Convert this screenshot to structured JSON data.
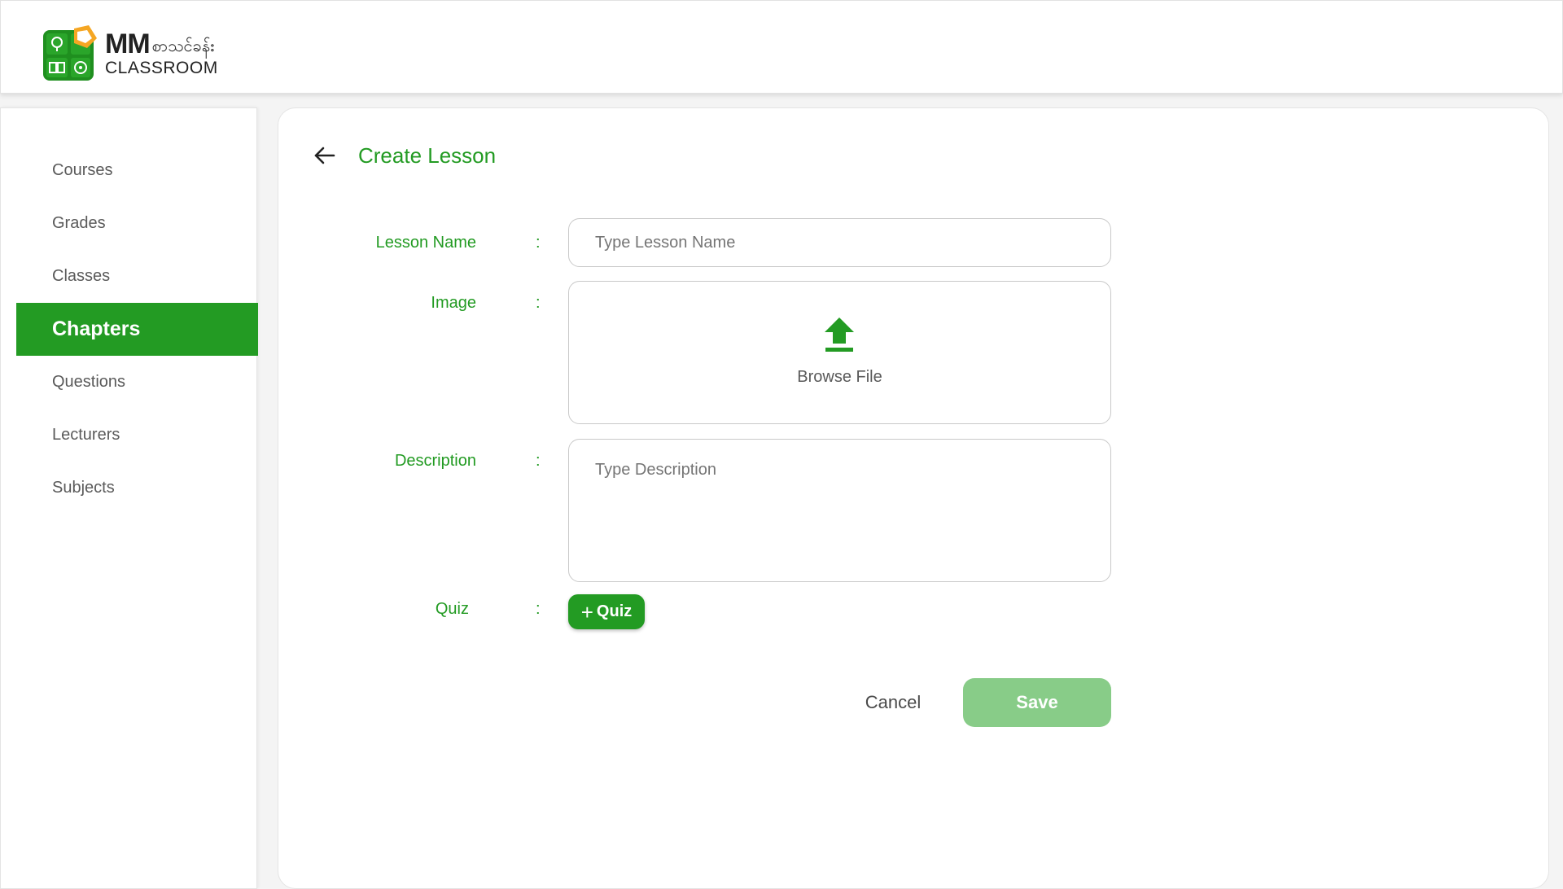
{
  "brand": {
    "mm": "MM",
    "script": "စာသင်ခန်း",
    "classroom": "CLASSROOM"
  },
  "sidebar": {
    "items": [
      {
        "label": "Courses",
        "active": false
      },
      {
        "label": "Grades",
        "active": false
      },
      {
        "label": "Classes",
        "active": false
      },
      {
        "label": "Chapters",
        "active": true
      },
      {
        "label": "Questions",
        "active": false
      },
      {
        "label": "Lecturers",
        "active": false
      },
      {
        "label": "Subjects",
        "active": false
      }
    ]
  },
  "page": {
    "title": "Create Lesson"
  },
  "form": {
    "colon": ":",
    "lesson_name": {
      "label": "Lesson Name",
      "value": "",
      "placeholder": "Type Lesson Name"
    },
    "image": {
      "label": "Image",
      "browse_label": "Browse File"
    },
    "description": {
      "label": "Description",
      "value": "",
      "placeholder": "Type Description"
    },
    "quiz": {
      "label": "Quiz",
      "button_label": "Quiz"
    }
  },
  "actions": {
    "cancel_label": "Cancel",
    "save_label": "Save"
  },
  "colors": {
    "accent": "#239b23",
    "save_disabled": "#88cc88"
  }
}
